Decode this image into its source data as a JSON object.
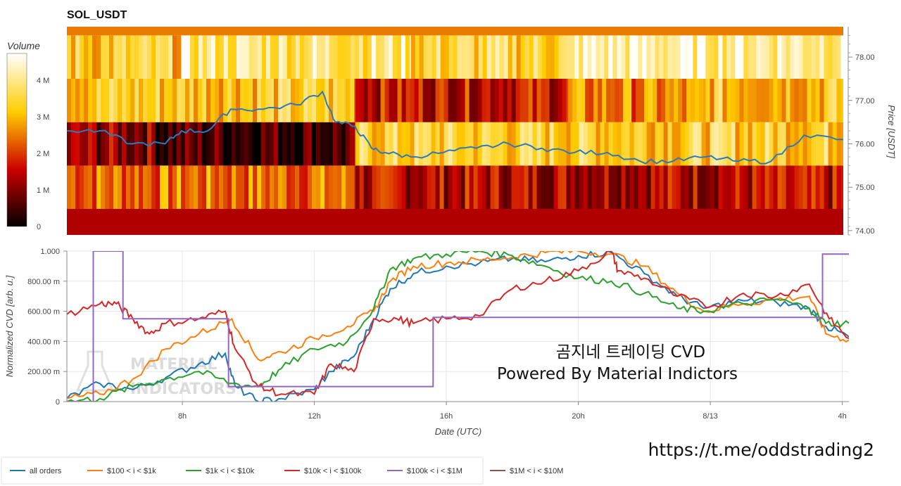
{
  "colors": {
    "all_orders": "#1f77b4",
    "r100_1k": "#ff7f0e",
    "r1k_10k": "#2ca02c",
    "r10k_100k": "#d62728",
    "r100k_1M": "#9467bd",
    "r1M_10M": "#8c564b"
  },
  "caption": {
    "line1": "곰지네 트레이딩 CVD",
    "line2": "Powered By Material Indictors"
  },
  "watermark": {
    "line1": "MATERIAL",
    "line2": "INDICATORS"
  },
  "url": "https://t.me/oddstrading2",
  "chart_data": [
    {
      "type": "heatmap",
      "title": "SOL_USDT",
      "colorbar_label": "Volume",
      "colorbar_ticks": [
        "0",
        "1 M",
        "2 M",
        "3 M",
        "4 M"
      ],
      "colorscale": "black-red-yellow-white",
      "ylabel": "Price [USDT]",
      "ylim": [
        73.9,
        78.7
      ],
      "y_ticks": [
        "74.00",
        "75.00",
        "76.00",
        "77.00",
        "78.00"
      ],
      "x_range_hours": [
        4.5,
        28.2
      ],
      "price_bands": [
        {
          "from": 73.9,
          "to": 74.5,
          "volume_pattern": [
            [
              4.5,
              28.2,
              1.2
            ]
          ]
        },
        {
          "from": 74.5,
          "to": 75.5,
          "volume_pattern": [
            [
              4.5,
              13.3,
              2.3
            ],
            [
              13.3,
              28.2,
              1.4
            ]
          ]
        },
        {
          "from": 75.5,
          "to": 76.5,
          "volume_pattern": [
            [
              4.5,
              7.2,
              1.1
            ],
            [
              7.2,
              13.3,
              0.6
            ],
            [
              13.3,
              28.2,
              3.2
            ]
          ]
        },
        {
          "from": 76.5,
          "to": 77.5,
          "volume_pattern": [
            [
              4.5,
              13.3,
              3.1
            ],
            [
              13.3,
              19.8,
              1.6
            ],
            [
              19.8,
              24.0,
              2.4
            ],
            [
              24.0,
              28.2,
              3.0
            ]
          ]
        },
        {
          "from": 77.5,
          "to": 78.5,
          "volume_pattern": [
            [
              4.5,
              8.0,
              3.1
            ],
            [
              8.0,
              15.0,
              3.7
            ],
            [
              15.0,
              20.0,
              3.3
            ],
            [
              20.0,
              28.2,
              4.0
            ]
          ]
        },
        {
          "from": 78.5,
          "to": 78.7,
          "volume_pattern": [
            [
              4.5,
              28.2,
              2.3
            ]
          ]
        }
      ],
      "price_line": {
        "x": [
          4.5,
          5.5,
          6.5,
          7.5,
          8.0,
          8.8,
          9.5,
          10.5,
          11.5,
          12.3,
          12.7,
          13.3,
          13.8,
          14.2,
          15.0,
          16.0,
          17.0,
          18.0,
          19.0,
          20.0,
          21.0,
          22.0,
          23.0,
          24.0,
          25.0,
          26.0,
          27.0,
          28.2
        ],
        "y": [
          76.3,
          76.3,
          76.0,
          76.0,
          76.3,
          76.3,
          76.8,
          76.8,
          76.9,
          77.2,
          76.5,
          76.4,
          75.9,
          75.8,
          75.7,
          75.8,
          75.9,
          76.0,
          75.9,
          75.8,
          75.8,
          75.6,
          75.6,
          75.7,
          75.6,
          75.6,
          76.2,
          76.1
        ]
      }
    },
    {
      "type": "line",
      "xlabel": "Date (UTC)",
      "ylabel": "Normalized CVD [arb. u.]",
      "ylim": [
        0,
        1
      ],
      "y_ticks": [
        "0",
        "200.00 m",
        "400.00 m",
        "600.00 m",
        "800.00 m",
        "1.000"
      ],
      "x_range_hours": [
        4.5,
        28.2
      ],
      "x_ticks": [
        {
          "hour": 8,
          "label": "8h"
        },
        {
          "hour": 12,
          "label": "12h"
        },
        {
          "hour": 16,
          "label": "16h"
        },
        {
          "hour": 20,
          "label": "20h"
        },
        {
          "hour": 24,
          "label": "8/13"
        },
        {
          "hour": 28,
          "label": "4h"
        }
      ],
      "legend_position": "bottom-left",
      "series": [
        {
          "name": "all orders",
          "color_key": "all_orders",
          "x": [
            4.5,
            5.5,
            6.5,
            7.5,
            8.5,
            9.3,
            9.6,
            10.3,
            11.0,
            12.0,
            12.5,
            13.2,
            13.8,
            14.3,
            15.0,
            16.0,
            17.0,
            18.0,
            19.0,
            20.0,
            21.0,
            22.0,
            23.0,
            23.8,
            25.0,
            26.0,
            27.0,
            27.5,
            28.2
          ],
          "y": [
            0.02,
            0.12,
            0.08,
            0.16,
            0.25,
            0.32,
            0.1,
            0.0,
            0.02,
            0.08,
            0.2,
            0.3,
            0.55,
            0.75,
            0.85,
            0.9,
            0.92,
            0.95,
            0.93,
            0.97,
            0.99,
            0.85,
            0.7,
            0.62,
            0.67,
            0.66,
            0.62,
            0.5,
            0.43
          ]
        },
        {
          "name": "$100 < i < $1k",
          "color_key": "r100_1k",
          "x": [
            4.5,
            5.5,
            6.5,
            7.5,
            8.5,
            9.5,
            10.3,
            11.0,
            12.0,
            13.0,
            13.8,
            14.3,
            15.0,
            16.0,
            17.0,
            18.0,
            19.0,
            20.0,
            21.0,
            22.0,
            23.0,
            23.8,
            25.0,
            26.0,
            27.0,
            27.5,
            28.2
          ],
          "y": [
            0.02,
            0.05,
            0.15,
            0.35,
            0.45,
            0.55,
            0.28,
            0.33,
            0.42,
            0.5,
            0.6,
            0.8,
            0.9,
            0.92,
            0.94,
            0.96,
            0.99,
            1.0,
            0.98,
            0.9,
            0.72,
            0.6,
            0.65,
            0.68,
            0.7,
            0.45,
            0.41
          ]
        },
        {
          "name": "$1k < i < $10k",
          "color_key": "r1k_10k",
          "x": [
            4.5,
            5.5,
            6.5,
            7.5,
            8.5,
            9.5,
            10.3,
            11.0,
            12.0,
            13.0,
            13.8,
            14.3,
            15.0,
            16.0,
            17.0,
            18.0,
            19.0,
            20.0,
            21.0,
            22.0,
            23.0,
            23.8,
            25.0,
            26.0,
            27.0,
            27.5,
            28.2
          ],
          "y": [
            0.0,
            0.02,
            0.1,
            0.15,
            0.2,
            0.12,
            0.1,
            0.22,
            0.35,
            0.4,
            0.62,
            0.88,
            0.95,
            0.98,
            1.0,
            0.97,
            0.9,
            0.82,
            0.8,
            0.72,
            0.62,
            0.6,
            0.65,
            0.68,
            0.62,
            0.52,
            0.52
          ]
        },
        {
          "name": "$10k < i < $100k",
          "color_key": "r10k_100k",
          "x": [
            4.5,
            5.5,
            6.0,
            6.5,
            7.0,
            7.5,
            8.5,
            9.3,
            9.6,
            10.3,
            11.0,
            12.0,
            12.5,
            13.2,
            13.8,
            14.5,
            15.0,
            16.0,
            17.0,
            18.0,
            19.0,
            20.0,
            21.0,
            21.2,
            22.0,
            23.0,
            24.0,
            25.0,
            26.0,
            27.0,
            27.6,
            28.2
          ],
          "y": [
            0.58,
            0.65,
            0.65,
            0.55,
            0.45,
            0.52,
            0.55,
            0.6,
            0.35,
            0.1,
            0.05,
            0.05,
            0.25,
            0.2,
            0.55,
            0.55,
            0.52,
            0.55,
            0.57,
            0.75,
            0.8,
            0.87,
            1.0,
            0.87,
            0.82,
            0.7,
            0.63,
            0.72,
            0.7,
            0.78,
            0.55,
            0.42
          ]
        },
        {
          "name": "$100k < i < $1M",
          "color_key": "r100k_1M",
          "x": [
            4.5,
            5.3,
            5.3,
            6.2,
            6.2,
            9.4,
            9.4,
            15.6,
            15.6,
            27.4,
            27.4,
            28.2
          ],
          "y": [
            0.0,
            0.0,
            1.0,
            1.0,
            0.55,
            0.55,
            0.1,
            0.1,
            0.56,
            0.56,
            0.98,
            0.98
          ]
        },
        {
          "name": "$1M < i < $10M",
          "color_key": "r1M_10M",
          "x": [],
          "y": []
        }
      ]
    }
  ]
}
